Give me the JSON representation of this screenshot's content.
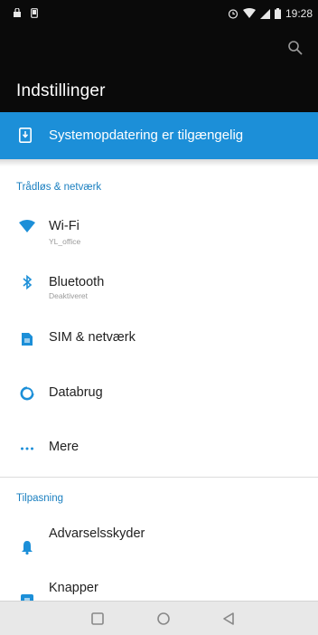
{
  "status_bar": {
    "time": "19:28",
    "left_icons": [
      "shop-icon",
      "notification-icon"
    ],
    "right_icons": [
      "alarm-icon",
      "wifi-icon",
      "signal-icon",
      "battery-icon"
    ]
  },
  "app_bar": {
    "title": "Indstillinger",
    "search_icon": "search-icon"
  },
  "banner": {
    "label": "Systemopdatering er tilgængelig",
    "icon": "system-update-icon"
  },
  "sections": [
    {
      "header": "Trådløs & netværk",
      "items": [
        {
          "label": "Wi-Fi",
          "sub": "YL_office",
          "icon": "wifi-icon"
        },
        {
          "label": "Bluetooth",
          "sub": "Deaktiveret",
          "icon": "bluetooth-icon"
        },
        {
          "label": "SIM & netværk",
          "icon": "sim-card-icon"
        },
        {
          "label": "Databrug",
          "icon": "data-usage-icon"
        },
        {
          "label": "Mere",
          "icon": "more-icon"
        }
      ]
    },
    {
      "header": "Tilpasning",
      "items": [
        {
          "label": "Advarselsskyder",
          "icon": "bell-icon"
        },
        {
          "label": "Knapper",
          "icon": "buttons-icon"
        }
      ]
    }
  ],
  "nav_bar": {
    "icons": [
      "recents-icon",
      "home-icon",
      "back-icon"
    ]
  },
  "colors": {
    "accent": "#1c8fd8",
    "section_header": "#1a7fc0",
    "app_bar": "#0a0a0a"
  }
}
